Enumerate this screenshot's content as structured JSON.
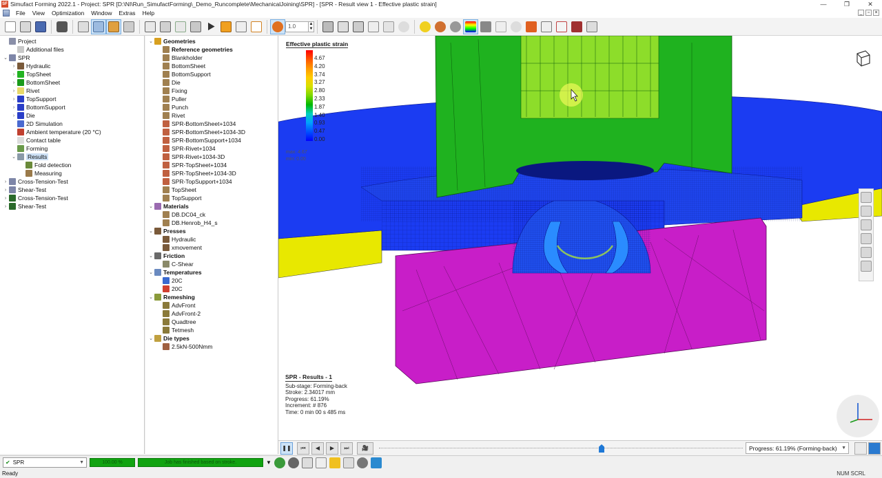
{
  "window": {
    "title": "Simufact Forming 2022.1 - Project: SPR [D:\\NI\\Run_SimufactForming\\_Demo_Runcomplete\\MechanicalJoining\\SPR] - [SPR - Result view 1 - Effective plastic strain]",
    "app_icon_text": "SF",
    "controls": [
      "—",
      "❐",
      "✕"
    ]
  },
  "menu": {
    "items": [
      "File",
      "View",
      "Optimization",
      "Window",
      "Extras",
      "Help"
    ],
    "mdi_controls": [
      "_",
      "▫",
      "×"
    ]
  },
  "toolbar": {
    "zoom_value": "1.0"
  },
  "project_tree": [
    {
      "label": "Project",
      "level": 0,
      "exp": "",
      "icon": "project-icon",
      "color": "#8a8fa8"
    },
    {
      "label": "Additional files",
      "level": 1,
      "exp": "",
      "icon": "files-icon",
      "color": "#c9c9c9"
    },
    {
      "label": "SPR",
      "level": 0,
      "exp": "⌄",
      "icon": "process-icon",
      "color": "#7e86a8"
    },
    {
      "label": "Hydraulic",
      "level": 1,
      "exp": "›",
      "icon": "press-icon",
      "color": "#7a5a3a"
    },
    {
      "label": "TopSheet",
      "level": 1,
      "exp": "›",
      "icon": "sheet-icon",
      "color": "#22b322"
    },
    {
      "label": "BottomSheet",
      "level": 1,
      "exp": "›",
      "icon": "sheet-icon",
      "color": "#1a9a1a"
    },
    {
      "label": "Rivet",
      "level": 1,
      "exp": "›",
      "icon": "rivet-icon",
      "color": "#e8d86a"
    },
    {
      "label": "TopSupport",
      "level": 1,
      "exp": "›",
      "icon": "tool-icon",
      "color": "#2a3ec8"
    },
    {
      "label": "BottomSupport",
      "level": 1,
      "exp": "›",
      "icon": "tool-icon",
      "color": "#2a3ec8"
    },
    {
      "label": "Die",
      "level": 1,
      "exp": "›",
      "icon": "die-icon",
      "color": "#2a3ec8"
    },
    {
      "label": "2D Simulation",
      "level": 1,
      "exp": "",
      "icon": "sim2d-icon",
      "color": "#4a6ad0"
    },
    {
      "label": "Ambient temperature (20 °C)",
      "level": 1,
      "exp": "",
      "icon": "thermometer-icon",
      "color": "#c04030"
    },
    {
      "label": "Contact table",
      "level": 1,
      "exp": "",
      "icon": "table-icon",
      "color": "#dcdcdc"
    },
    {
      "label": "Forming",
      "level": 1,
      "exp": "",
      "icon": "forming-icon",
      "color": "#6a9a4a"
    },
    {
      "label": "Results",
      "level": 1,
      "exp": "⌄",
      "icon": "results-icon",
      "color": "#8a9aa8",
      "selected": true
    },
    {
      "label": "Fold detection",
      "level": 2,
      "exp": "",
      "icon": "fold-icon",
      "color": "#6a8a3a"
    },
    {
      "label": "Measuring",
      "level": 2,
      "exp": "",
      "icon": "ruler-icon",
      "color": "#9a7a4a"
    },
    {
      "label": "Cross-Tension-Test",
      "level": 0,
      "exp": "›",
      "icon": "process-icon",
      "color": "#7e86a8"
    },
    {
      "label": "Shear-Test",
      "level": 0,
      "exp": "›",
      "icon": "process-icon",
      "color": "#7e86a8"
    },
    {
      "label": "Cross-Tension-Test",
      "level": 0,
      "exp": "›",
      "icon": "process3d-icon",
      "color": "#2a6a2a"
    },
    {
      "label": "Shear-Test",
      "level": 0,
      "exp": "›",
      "icon": "process3d-icon",
      "color": "#2a6a2a"
    }
  ],
  "library_tree": [
    {
      "label": "Geometries",
      "level": 0,
      "exp": "⌄",
      "icon": "geometries-icon",
      "color": "#d8a020",
      "bold": true
    },
    {
      "label": "Reference geometries",
      "level": 1,
      "exp": "",
      "icon": "ref-geometry-icon",
      "color": "#a08050",
      "bold": true
    },
    {
      "label": "Blankholder",
      "level": 1,
      "exp": "",
      "icon": "geometry-icon",
      "color": "#a08050"
    },
    {
      "label": "BottomSheet",
      "level": 1,
      "exp": "",
      "icon": "geometry-icon",
      "color": "#a08050"
    },
    {
      "label": "BottomSupport",
      "level": 1,
      "exp": "",
      "icon": "geometry-icon",
      "color": "#a08050"
    },
    {
      "label": "Die",
      "level": 1,
      "exp": "",
      "icon": "geometry-icon",
      "color": "#a08050"
    },
    {
      "label": "Fixing",
      "level": 1,
      "exp": "",
      "icon": "geometry-icon",
      "color": "#a08050"
    },
    {
      "label": "Puller",
      "level": 1,
      "exp": "",
      "icon": "geometry-icon",
      "color": "#a08050"
    },
    {
      "label": "Punch",
      "level": 1,
      "exp": "",
      "icon": "geometry-icon",
      "color": "#a08050"
    },
    {
      "label": "Rivet",
      "level": 1,
      "exp": "",
      "icon": "geometry-icon",
      "color": "#a08050"
    },
    {
      "label": "SPR-BottomSheet+1034",
      "level": 1,
      "exp": "",
      "icon": "result-geometry-icon",
      "color": "#c06040"
    },
    {
      "label": "SPR-BottomSheet+1034-3D",
      "level": 1,
      "exp": "",
      "icon": "result-geometry-icon",
      "color": "#c06040"
    },
    {
      "label": "SPR-BottomSupport+1034",
      "level": 1,
      "exp": "",
      "icon": "result-geometry-icon",
      "color": "#c06040"
    },
    {
      "label": "SPR-Rivet+1034",
      "level": 1,
      "exp": "",
      "icon": "result-geometry-icon",
      "color": "#c06040"
    },
    {
      "label": "SPR-Rivet+1034-3D",
      "level": 1,
      "exp": "",
      "icon": "result-geometry-icon",
      "color": "#c06040"
    },
    {
      "label": "SPR-TopSheet+1034",
      "level": 1,
      "exp": "",
      "icon": "result-geometry-icon",
      "color": "#c06040"
    },
    {
      "label": "SPR-TopSheet+1034-3D",
      "level": 1,
      "exp": "",
      "icon": "result-geometry-icon",
      "color": "#c06040"
    },
    {
      "label": "SPR-TopSupport+1034",
      "level": 1,
      "exp": "",
      "icon": "result-geometry-icon",
      "color": "#c06040"
    },
    {
      "label": "TopSheet",
      "level": 1,
      "exp": "",
      "icon": "geometry-icon",
      "color": "#a08050"
    },
    {
      "label": "TopSupport",
      "level": 1,
      "exp": "",
      "icon": "geometry-icon",
      "color": "#a08050"
    },
    {
      "label": "Materials",
      "level": 0,
      "exp": "⌄",
      "icon": "materials-icon",
      "color": "#9a6ab0",
      "bold": true
    },
    {
      "label": "DB.DC04_ck",
      "level": 1,
      "exp": "",
      "icon": "material-icon",
      "color": "#a08050"
    },
    {
      "label": "DB.Henrob_H4_s",
      "level": 1,
      "exp": "",
      "icon": "material-icon",
      "color": "#a08050"
    },
    {
      "label": "Presses",
      "level": 0,
      "exp": "⌄",
      "icon": "presses-icon",
      "color": "#7a5a3a",
      "bold": true
    },
    {
      "label": "Hydraulic",
      "level": 1,
      "exp": "",
      "icon": "press-icon",
      "color": "#7a5a3a"
    },
    {
      "label": "xmovement",
      "level": 1,
      "exp": "",
      "icon": "press-icon",
      "color": "#7a5a3a"
    },
    {
      "label": "Friction",
      "level": 0,
      "exp": "⌄",
      "icon": "friction-icon",
      "color": "#6a6a6a",
      "bold": true
    },
    {
      "label": "C-Shear",
      "level": 1,
      "exp": "",
      "icon": "friction-item-icon",
      "color": "#8a8a6a"
    },
    {
      "label": "Temperatures",
      "level": 0,
      "exp": "⌄",
      "icon": "temperatures-icon",
      "color": "#6a8ac0",
      "bold": true
    },
    {
      "label": "20C",
      "level": 1,
      "exp": "",
      "icon": "temperature-icon",
      "color": "#3a6ad0"
    },
    {
      "label": "20C",
      "level": 1,
      "exp": "",
      "icon": "temperature-icon",
      "color": "#d04030"
    },
    {
      "label": "Remeshing",
      "level": 0,
      "exp": "⌄",
      "icon": "remeshing-icon",
      "color": "#8a9a3a",
      "bold": true
    },
    {
      "label": "AdvFront",
      "level": 1,
      "exp": "",
      "icon": "mesh-icon",
      "color": "#8a7a3a"
    },
    {
      "label": "AdvFront-2",
      "level": 1,
      "exp": "",
      "icon": "mesh-icon",
      "color": "#8a7a3a"
    },
    {
      "label": "Quadtree",
      "level": 1,
      "exp": "",
      "icon": "mesh-icon",
      "color": "#8a7a3a"
    },
    {
      "label": "Tetmesh",
      "level": 1,
      "exp": "",
      "icon": "mesh-icon",
      "color": "#8a7a3a"
    },
    {
      "label": "Die types",
      "level": 0,
      "exp": "⌄",
      "icon": "die-types-icon",
      "color": "#c0a040",
      "bold": true
    },
    {
      "label": "2.5kN-500Nmm",
      "level": 1,
      "exp": "",
      "icon": "die-type-icon",
      "color": "#a06040"
    }
  ],
  "legend": {
    "title": "Effective plastic strain",
    "values": [
      "4.67",
      "4.20",
      "3.74",
      "3.27",
      "2.80",
      "2.33",
      "1.87",
      "1.40",
      "0.93",
      "0.47",
      "0.00"
    ],
    "max_label": "max: 4.67",
    "min_label": "min: 0.00"
  },
  "result_info": {
    "header": "SPR - Results - 1",
    "lines": [
      "Sub-stage: Forming-back",
      "Stroke: 2.34017 mm",
      "Progress: 61.19%",
      "Increment: # 876",
      "Time: 0 min 00 s 485 ms"
    ]
  },
  "playback": {
    "progress_label": "Progress: 61.19% (Forming-back)",
    "progress_fraction": 0.6119
  },
  "status": {
    "run_name": "SPR",
    "progress_text": "100.00 %",
    "message": "Job has finished based on stroke.",
    "ready": "Ready",
    "indicators": "NUM  SCRL"
  },
  "colors": {
    "punch_green": "#1fb21f",
    "sheet_blue": "#1a3af0",
    "die_magenta": "#c81ec8",
    "support_yellow": "#e8e800",
    "selection": "#cde3f7"
  }
}
